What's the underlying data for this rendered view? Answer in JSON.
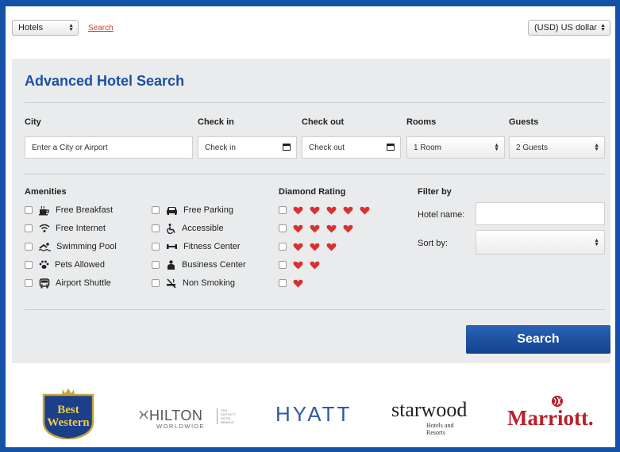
{
  "topbar": {
    "category_select": "Hotels",
    "search_link": "Search",
    "currency_select": "(USD) US dollar"
  },
  "panel": {
    "title": "Advanced Hotel Search",
    "labels": {
      "city": "City",
      "checkin": "Check in",
      "checkout": "Check out",
      "rooms": "Rooms",
      "guests": "Guests"
    },
    "city_placeholder": "Enter a City or Airport",
    "checkin_value": "Check in",
    "checkout_value": "Check out",
    "rooms_value": "1 Room",
    "guests_value": "2 Guests",
    "amenities_title": "Amenities",
    "amenities_col1": [
      {
        "label": "Free Breakfast",
        "icon": "breakfast-icon"
      },
      {
        "label": "Free Internet",
        "icon": "wifi-icon"
      },
      {
        "label": "Swimming Pool",
        "icon": "pool-icon"
      },
      {
        "label": "Pets Allowed",
        "icon": "paw-icon"
      },
      {
        "label": "Airport Shuttle",
        "icon": "shuttle-icon"
      }
    ],
    "amenities_col2": [
      {
        "label": "Free Parking",
        "icon": "car-icon"
      },
      {
        "label": "Accessible",
        "icon": "wheelchair-icon"
      },
      {
        "label": "Fitness Center",
        "icon": "dumbbell-icon"
      },
      {
        "label": "Business Center",
        "icon": "business-icon"
      },
      {
        "label": "Non Smoking",
        "icon": "no-smoking-icon"
      }
    ],
    "diamond_title": "Diamond Rating",
    "diamond_ratings": [
      5,
      4,
      3,
      2,
      1
    ],
    "filter_title": "Filter by",
    "hotel_name_label": "Hotel name:",
    "sort_by_label": "Sort by:",
    "search_button": "Search",
    "heart_color": "#d8322e"
  },
  "logos": {
    "best_western": [
      "Best",
      "Western"
    ],
    "hilton_main": "HILTON",
    "hilton_sub": "WORLDWIDE",
    "hilton_tag": [
      "TEN",
      "DISTINCT",
      "HOTEL",
      "BRANDS"
    ],
    "hyatt": "HYATT",
    "starwood_main": "starwood",
    "starwood_sub": [
      "Hotels and",
      "Resorts"
    ],
    "marriott": "Marriott."
  },
  "colors": {
    "brand_blue": "#1b50a0",
    "frame_blue": "#1452a8",
    "button_blue": "#1a4c9c",
    "link_red": "#d0402f"
  }
}
